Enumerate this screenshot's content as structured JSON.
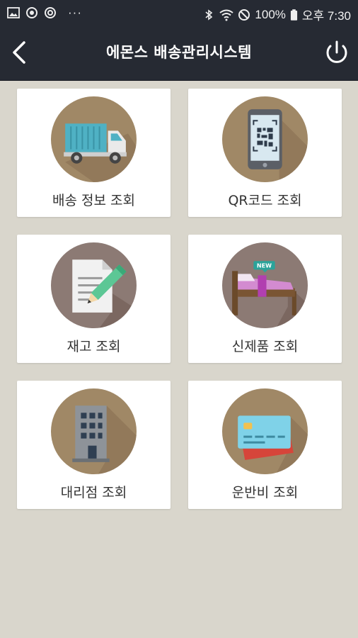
{
  "status_bar": {
    "battery": "100%",
    "time": "오후 7:30",
    "left_icons": [
      "gallery-icon",
      "sync-icon",
      "sync-icon",
      "more-dots-icon"
    ],
    "more": "···"
  },
  "header": {
    "title": "에몬스 배송관리시스템",
    "back_icon": "back-arrow-icon",
    "power_icon": "power-icon",
    "background": "#262a33"
  },
  "menu": {
    "items": [
      {
        "label": "배송 정보 조회",
        "icon": "truck-icon"
      },
      {
        "label": "QR코드 조회",
        "icon": "qr-phone-icon"
      },
      {
        "label": "재고 조회",
        "icon": "document-pencil-icon"
      },
      {
        "label": "신제품 조회",
        "icon": "new-bed-icon",
        "badge": "NEW"
      },
      {
        "label": "대리점 조회",
        "icon": "building-icon"
      },
      {
        "label": "운반비 조회",
        "icon": "credit-card-icon"
      }
    ]
  },
  "colors": {
    "background": "#d9d6cc",
    "card": "#ffffff",
    "icon_circle": "#a08866",
    "icon_circle_alt": "#8c7a74"
  }
}
